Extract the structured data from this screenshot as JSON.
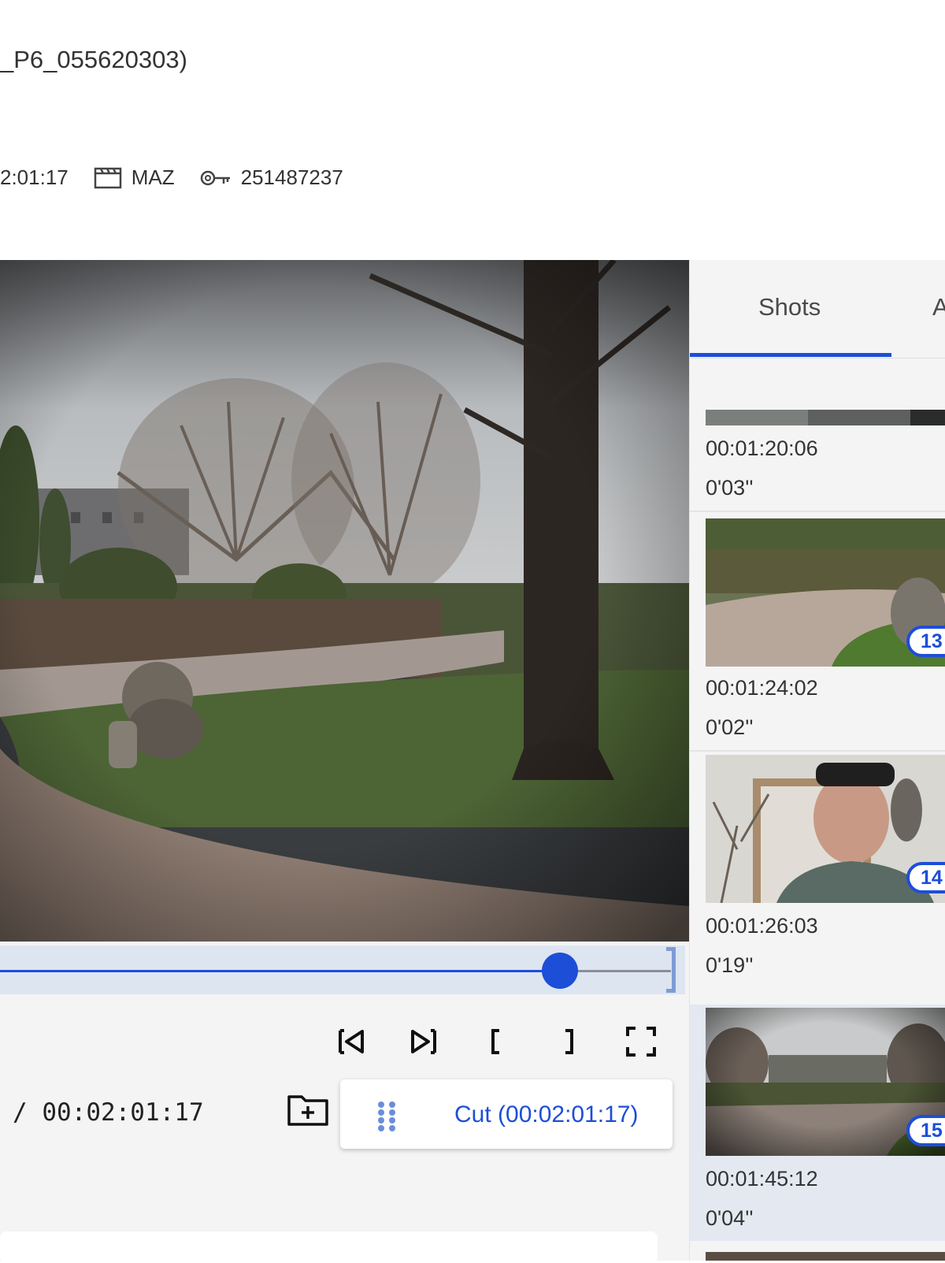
{
  "header": {
    "title": "_P6_055620303)",
    "meta": {
      "duration": "2:01:17",
      "format": "MAZ",
      "id": "251487237"
    }
  },
  "player": {
    "timecode": "/ 00:02:01:17",
    "progress_fraction": 0.81,
    "cut_label": "Cut (00:02:01:17)"
  },
  "panel": {
    "tabs": [
      {
        "label": "Shots",
        "active": true
      },
      {
        "label": "A",
        "active": false
      }
    ],
    "shots": [
      {
        "time": "00:01:20:06",
        "duration": "0'03''",
        "badge": ""
      },
      {
        "time": "00:01:24:02",
        "duration": "0'02''",
        "badge": "13"
      },
      {
        "time": "00:01:26:03",
        "duration": "0'19''",
        "badge": "14"
      },
      {
        "time": "00:01:45:12",
        "duration": "0'04''",
        "badge": "15"
      }
    ]
  },
  "colors": {
    "accent": "#1d4ed8",
    "panel_bg": "#f4f4f5",
    "active_shot_bg": "#e4e8f1"
  }
}
